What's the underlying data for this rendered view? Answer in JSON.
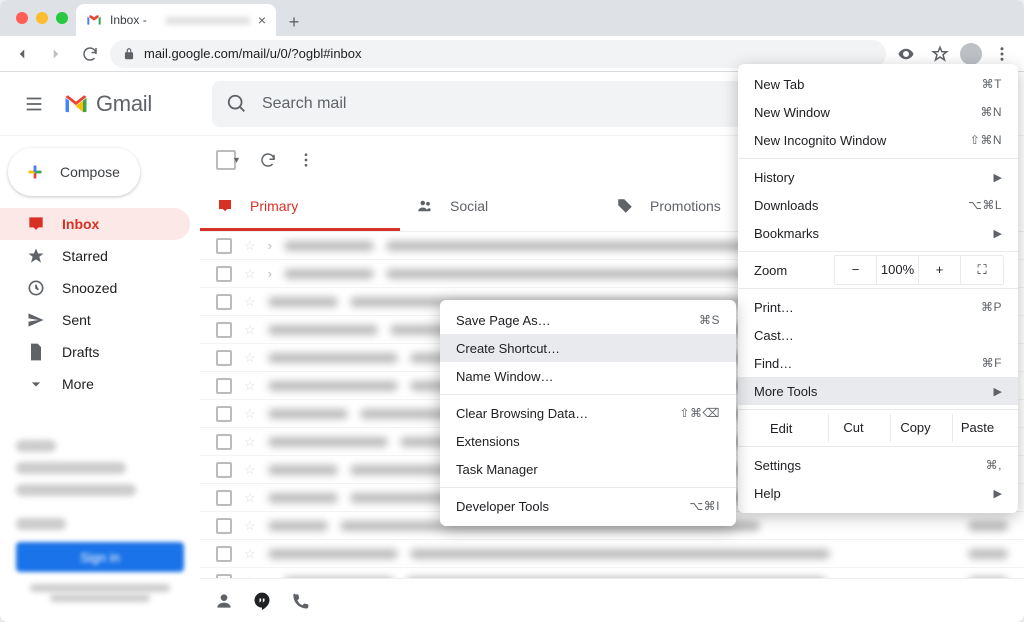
{
  "browser": {
    "tab_title": "Inbox -",
    "url": "mail.google.com/mail/u/0/?ogbl#inbox"
  },
  "gmail": {
    "logo_text": "Gmail",
    "search_placeholder": "Search mail",
    "compose_label": "Compose",
    "sidebar": [
      {
        "icon": "inbox",
        "label": "Inbox",
        "active": true
      },
      {
        "icon": "star",
        "label": "Starred"
      },
      {
        "icon": "snooze",
        "label": "Snoozed"
      },
      {
        "icon": "sent",
        "label": "Sent"
      },
      {
        "icon": "drafts",
        "label": "Drafts"
      },
      {
        "icon": "more",
        "label": "More"
      }
    ],
    "tabs": {
      "primary": "Primary",
      "social": "Social",
      "promotions": "Promotions"
    }
  },
  "main_menu": {
    "new_tab": "New Tab",
    "new_tab_kbd": "⌘T",
    "new_window": "New Window",
    "new_window_kbd": "⌘N",
    "new_incognito": "New Incognito Window",
    "new_incognito_kbd": "⇧⌘N",
    "history": "History",
    "downloads": "Downloads",
    "downloads_kbd": "⌥⌘L",
    "bookmarks": "Bookmarks",
    "zoom": "Zoom",
    "zoom_value": "100%",
    "print": "Print…",
    "print_kbd": "⌘P",
    "cast": "Cast…",
    "find": "Find…",
    "find_kbd": "⌘F",
    "more_tools": "More Tools",
    "edit": "Edit",
    "cut": "Cut",
    "copy": "Copy",
    "paste": "Paste",
    "settings": "Settings",
    "settings_kbd": "⌘,",
    "help": "Help"
  },
  "sub_menu": {
    "save_page": "Save Page As…",
    "save_page_kbd": "⌘S",
    "create_shortcut": "Create Shortcut…",
    "name_window": "Name Window…",
    "clear_browsing": "Clear Browsing Data…",
    "clear_browsing_kbd": "⇧⌘⌫",
    "extensions": "Extensions",
    "task_manager": "Task Manager",
    "developer_tools": "Developer Tools",
    "developer_tools_kbd": "⌥⌘I"
  }
}
